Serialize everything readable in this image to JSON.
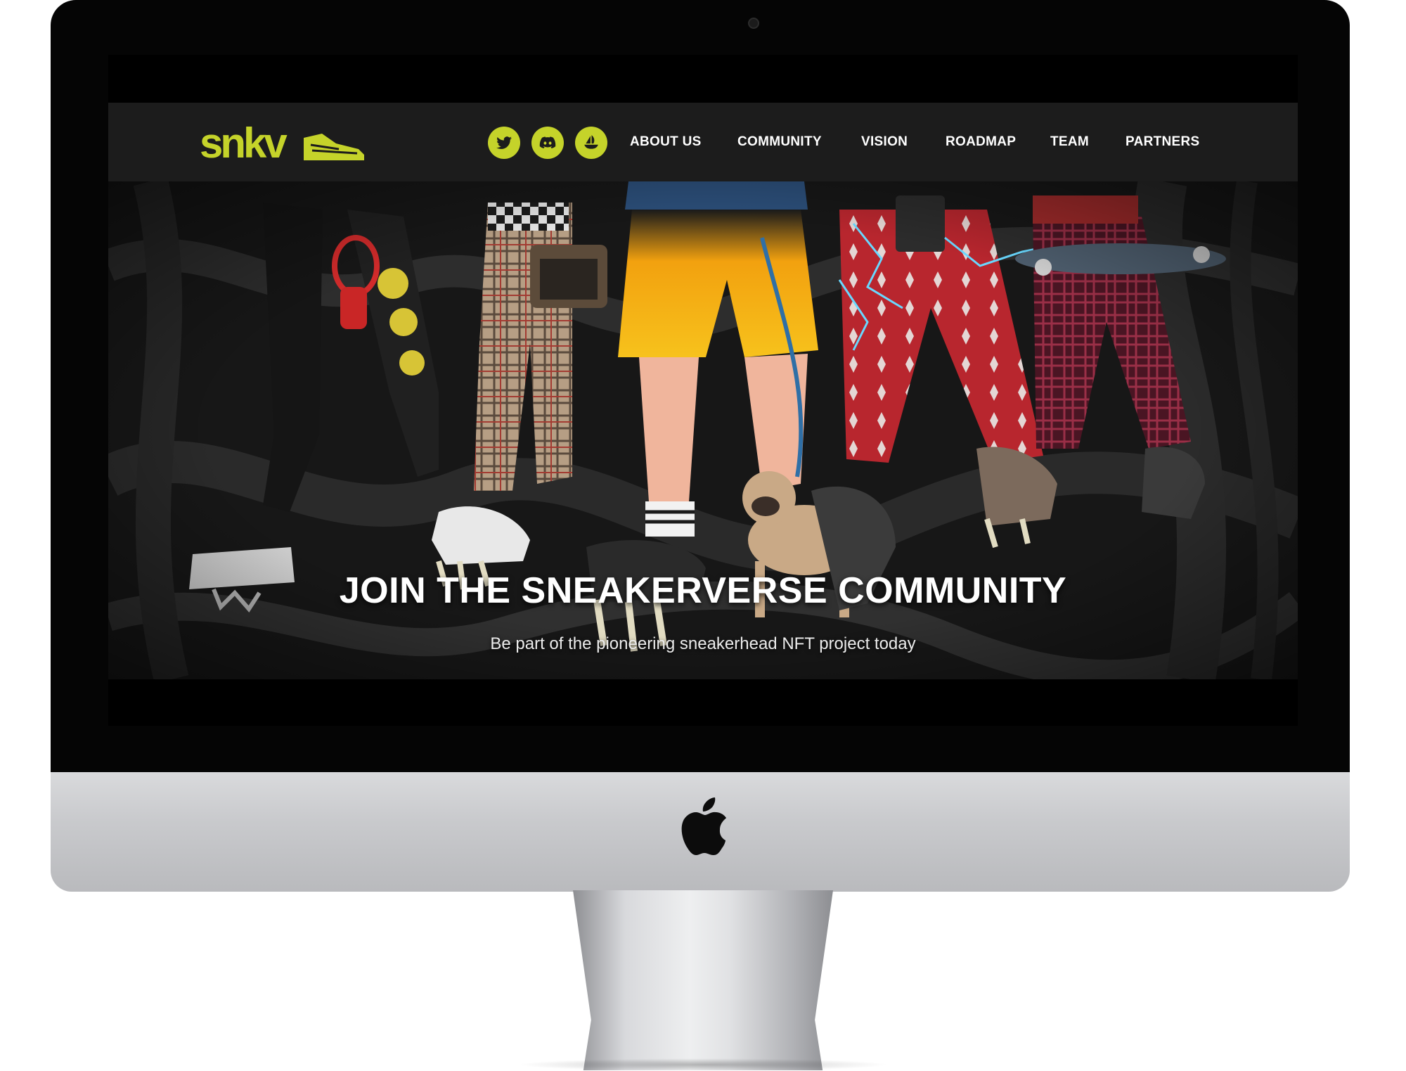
{
  "brand": {
    "logo_text": "snkv",
    "accent_color": "#c5d32a"
  },
  "social_icons": [
    {
      "name": "twitter-icon"
    },
    {
      "name": "discord-icon"
    },
    {
      "name": "opensea-icon"
    }
  ],
  "nav": {
    "items": [
      {
        "label": "ABOUT US"
      },
      {
        "label": "COMMUNITY"
      },
      {
        "label": "VISION"
      },
      {
        "label": "ROADMAP"
      },
      {
        "label": "TEAM"
      },
      {
        "label": "PARTNERS"
      }
    ]
  },
  "hero": {
    "title": "JOIN THE SNEAKERVERSE COMMUNITY",
    "subtitle": "Be part of the pioneering sneakerhead NFT project today"
  },
  "colors": {
    "navbar_bg": "#1c1c1c",
    "hero_bg": "#161616",
    "device_bezel": "#050505",
    "device_chin": "#c9cacd"
  }
}
